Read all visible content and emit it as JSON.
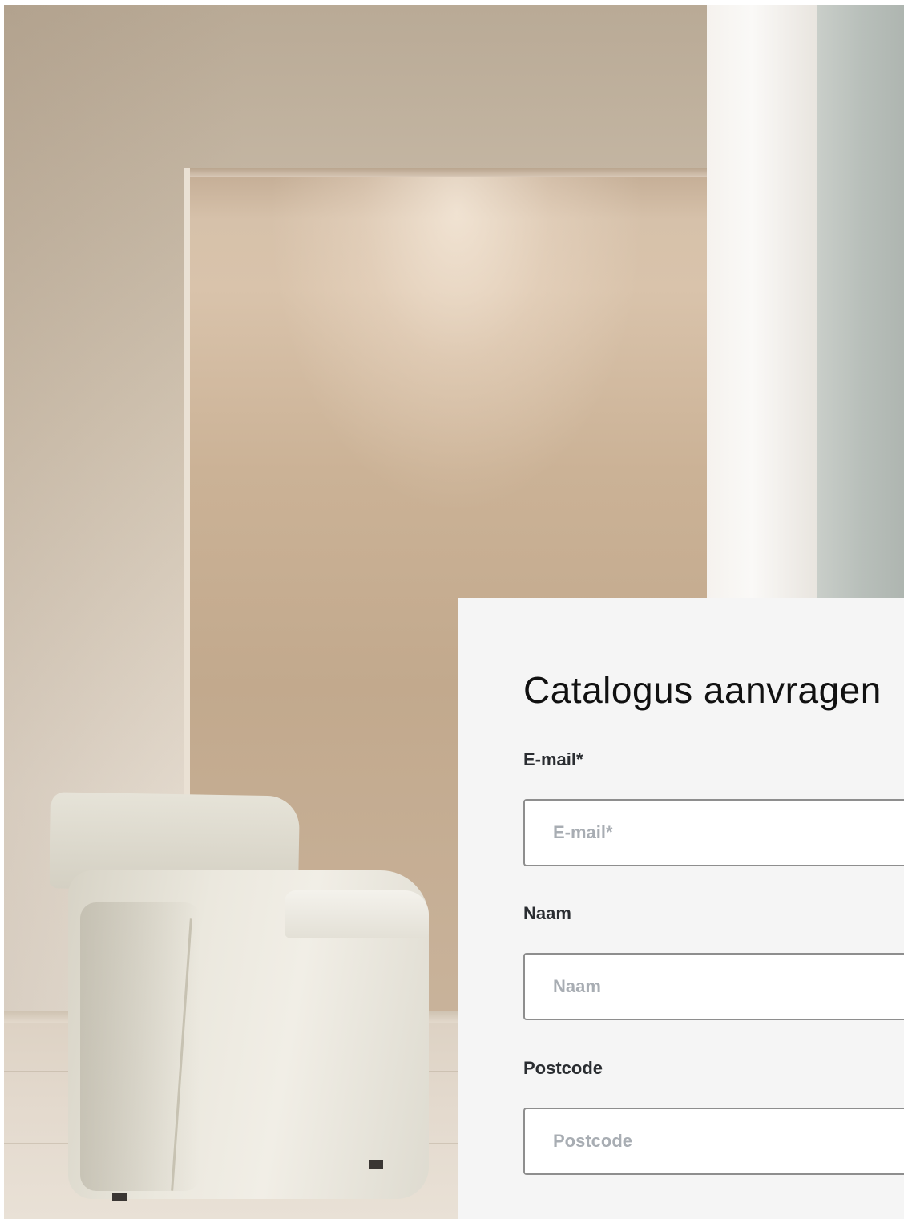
{
  "form": {
    "title": "Catalogus aanvragen",
    "fields": [
      {
        "label": "E-mail*",
        "placeholder": "E-mail*",
        "value": ""
      },
      {
        "label": "Naam",
        "placeholder": "Naam",
        "value": ""
      },
      {
        "label": "Postcode",
        "placeholder": "Postcode",
        "value": ""
      }
    ]
  },
  "colors": {
    "panel_background": "#f5f5f5",
    "title_text": "#111111",
    "label_text": "#2a2d31",
    "placeholder_text": "#a8adb3",
    "input_border": "#8e8e8e"
  }
}
